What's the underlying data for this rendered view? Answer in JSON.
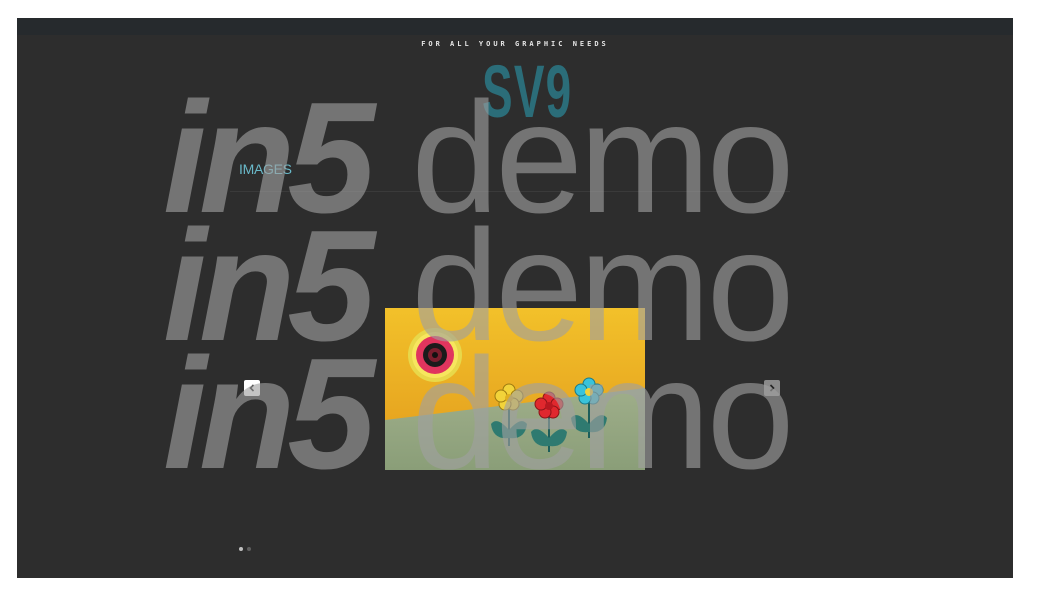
{
  "header": {
    "tagline": "FOR ALL YOUR GRAPHIC NEEDS",
    "logo": "SV9"
  },
  "section": {
    "title": "IMAGES"
  },
  "slideshow": {
    "prev_icon": "chevron-left-icon",
    "next_icon": "chevron-right-icon",
    "slide_count": 2,
    "active_index": 0,
    "slide_image": "flowers-and-circle-illustration"
  },
  "watermark": {
    "lines": [
      {
        "strong": "in5",
        "light": "demo"
      },
      {
        "strong": "in5",
        "light": "demo"
      },
      {
        "strong": "in5",
        "light": "demo"
      }
    ]
  },
  "colors": {
    "background": "#2d2d2d",
    "logo": "#2b6d79",
    "accent": "#69b9c9"
  }
}
